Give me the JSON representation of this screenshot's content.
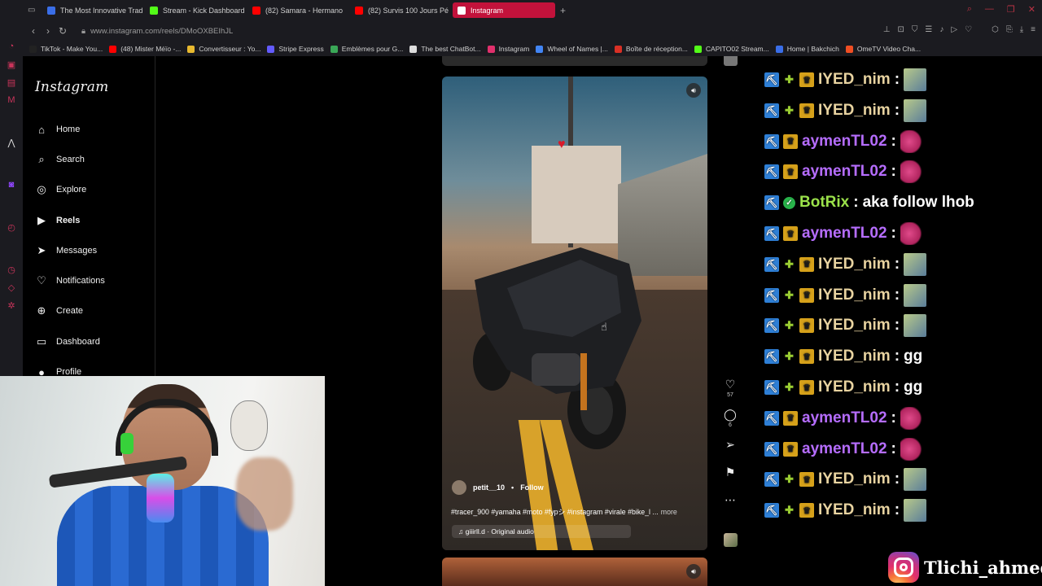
{
  "browser": {
    "tabs": [
      {
        "label": "The Most Innovative Trad",
        "color": "#3a6ee8"
      },
      {
        "label": "Stream - Kick Dashboard",
        "color": "#53fc18"
      },
      {
        "label": "(82) Samara - Hermano",
        "color": "#ff0000"
      },
      {
        "label": "(82) Survis 100 Jours Pé",
        "color": "#ff0000"
      },
      {
        "label": "Instagram",
        "color": "#e1306c"
      }
    ],
    "url": "www.instagram.com/reels/DMoOXBEIhJL",
    "bookmarks": [
      {
        "label": "TikTok - Make You...",
        "color": "#111111"
      },
      {
        "label": "(48) Mister Méïo -...",
        "color": "#ff0000"
      },
      {
        "label": "Convertisseur : Yo...",
        "color": "#e8b92f"
      },
      {
        "label": "Stripe Express",
        "color": "#635bff"
      },
      {
        "label": "Emblèmes pour G...",
        "color": "#3aa757"
      },
      {
        "label": "The best ChatBot...",
        "color": "#dddddd"
      },
      {
        "label": "Instagram",
        "color": "#e1306c"
      },
      {
        "label": "Wheel of Names |...",
        "color": "#4285f4"
      },
      {
        "label": "Boîte de réception...",
        "color": "#d93025"
      },
      {
        "label": "CAPITO02 Stream...",
        "color": "#53fc18"
      },
      {
        "label": "Home | Bakchich",
        "color": "#3a6ee8"
      },
      {
        "label": "OmeTV Video Cha...",
        "color": "#f04e23"
      }
    ]
  },
  "sidebar": {
    "logo": "Instagram",
    "items": [
      {
        "label": "Home",
        "icon": "⌂"
      },
      {
        "label": "Search",
        "icon": "⌕"
      },
      {
        "label": "Explore",
        "icon": "◎"
      },
      {
        "label": "Reels",
        "icon": "▶"
      },
      {
        "label": "Messages",
        "icon": "➤"
      },
      {
        "label": "Notifications",
        "icon": "♡"
      },
      {
        "label": "Create",
        "icon": "⊕"
      },
      {
        "label": "Dashboard",
        "icon": "▭"
      },
      {
        "label": "Profile",
        "icon": "●"
      }
    ]
  },
  "reel": {
    "username": "petit__10",
    "separator": "•",
    "follow_label": "Follow",
    "caption": "#tracer_900 #yamaha #moto #fypシ #instagram #virale #bike_l ...",
    "more_label": "more",
    "audio": "giiirll.d · Original audio",
    "likes": "57",
    "comments": "6"
  },
  "chat": [
    {
      "user": "IYED_nim",
      "color": "#e8d3a0",
      "badges": [
        "pick",
        "plus",
        "crown"
      ],
      "text": "",
      "emote": "face"
    },
    {
      "user": "IYED_nim",
      "color": "#e8d3a0",
      "badges": [
        "pick",
        "plus",
        "crown"
      ],
      "text": "",
      "emote": "face"
    },
    {
      "user": "aymenTL02",
      "color": "#b66dff",
      "badges": [
        "pick",
        "crown"
      ],
      "text": "",
      "emote": "heart"
    },
    {
      "user": "aymenTL02",
      "color": "#b66dff",
      "badges": [
        "pick",
        "crown"
      ],
      "text": "",
      "emote": "heart"
    },
    {
      "user": "BotRix",
      "color": "#9be24a",
      "badges": [
        "pick",
        "check"
      ],
      "text": "aka follow lhob",
      "emote": ""
    },
    {
      "user": "aymenTL02",
      "color": "#b66dff",
      "badges": [
        "pick",
        "crown"
      ],
      "text": "",
      "emote": "heart"
    },
    {
      "user": "IYED_nim",
      "color": "#e8d3a0",
      "badges": [
        "pick",
        "plus",
        "crown"
      ],
      "text": "",
      "emote": "face"
    },
    {
      "user": "IYED_nim",
      "color": "#e8d3a0",
      "badges": [
        "pick",
        "plus",
        "crown"
      ],
      "text": "",
      "emote": "face"
    },
    {
      "user": "IYED_nim",
      "color": "#e8d3a0",
      "badges": [
        "pick",
        "plus",
        "crown"
      ],
      "text": "",
      "emote": "face"
    },
    {
      "user": "IYED_nim",
      "color": "#e8d3a0",
      "badges": [
        "pick",
        "plus",
        "crown"
      ],
      "text": "gg",
      "emote": ""
    },
    {
      "user": "IYED_nim",
      "color": "#e8d3a0",
      "badges": [
        "pick",
        "plus",
        "crown"
      ],
      "text": "gg",
      "emote": ""
    },
    {
      "user": "aymenTL02",
      "color": "#b66dff",
      "badges": [
        "pick",
        "crown"
      ],
      "text": "",
      "emote": "heart"
    },
    {
      "user": "aymenTL02",
      "color": "#b66dff",
      "badges": [
        "pick",
        "crown"
      ],
      "text": "",
      "emote": "heart"
    },
    {
      "user": "IYED_nim",
      "color": "#e8d3a0",
      "badges": [
        "pick",
        "plus",
        "crown"
      ],
      "text": "",
      "emote": "face"
    },
    {
      "user": "IYED_nim",
      "color": "#e8d3a0",
      "badges": [
        "pick",
        "plus",
        "crown"
      ],
      "text": "",
      "emote": "face"
    }
  ],
  "overlay": {
    "handle": "Tlichi_ahmed"
  }
}
